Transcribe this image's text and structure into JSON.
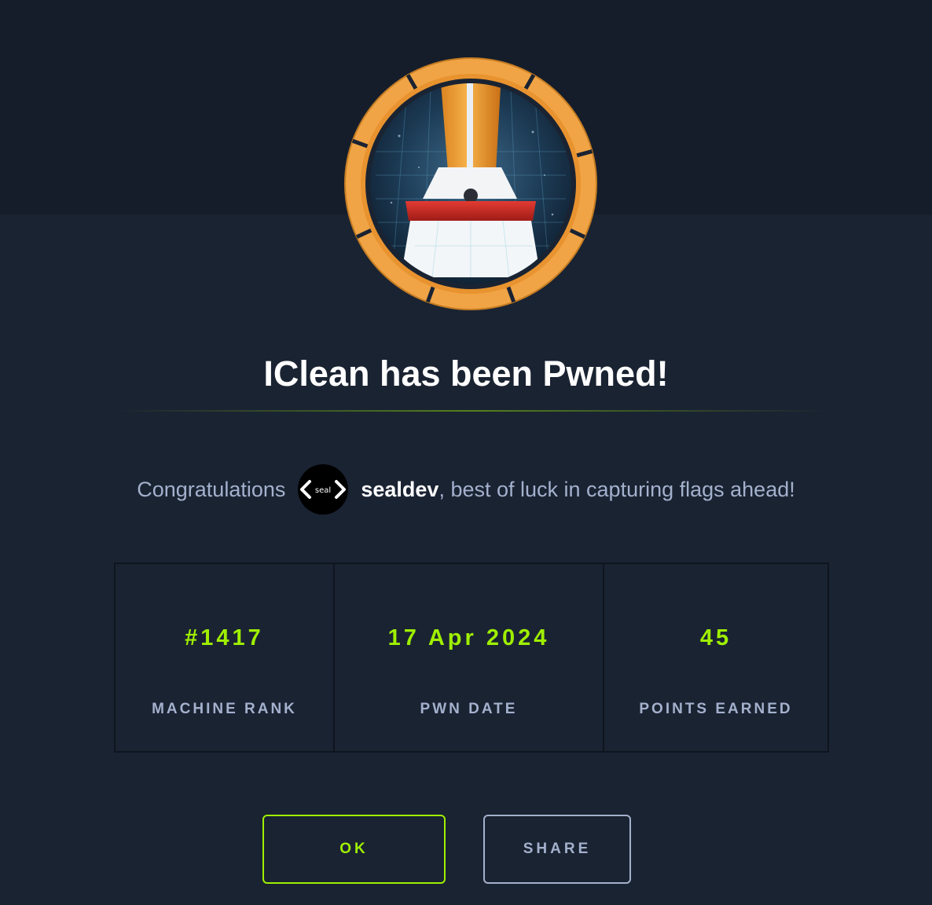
{
  "dialog": {
    "machine_name": "IClean",
    "title": "IClean has been Pwned!",
    "congrats_prefix": "Congratulations",
    "username": "sealdev",
    "congrats_suffix": ", best of luck in capturing flags ahead!",
    "avatar_text": "seal",
    "badge_icon": "broom-icon"
  },
  "stats": [
    {
      "value": "#1417",
      "label": "MACHINE RANK"
    },
    {
      "value": "17 Apr 2024",
      "label": "PWN DATE"
    },
    {
      "value": "45",
      "label": "POINTS EARNED"
    }
  ],
  "buttons": {
    "ok_label": "OK",
    "share_label": "SHARE"
  },
  "colors": {
    "accent": "#9fef00",
    "background": "#1a2332",
    "header_background": "#151d2b",
    "text_muted": "#a4b1cd",
    "badge_ring": "#f0a445"
  }
}
